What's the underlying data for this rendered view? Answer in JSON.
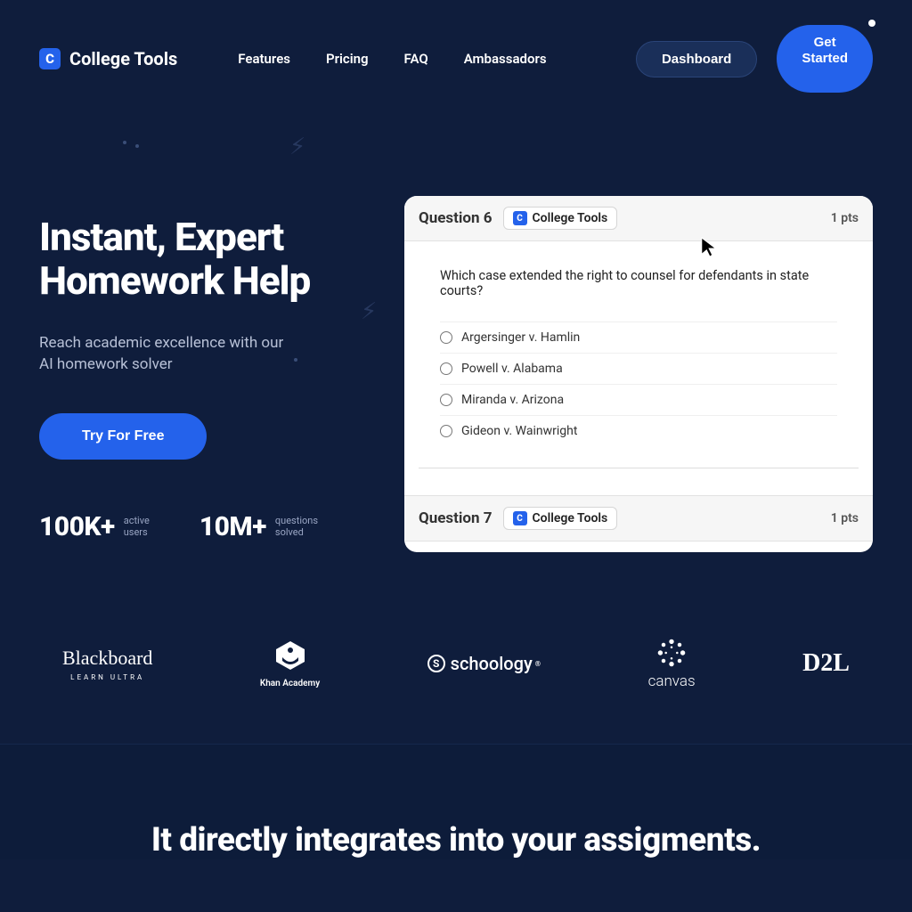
{
  "brand": {
    "logo_letter": "C",
    "name": "College Tools"
  },
  "nav": {
    "features": "Features",
    "pricing": "Pricing",
    "faq": "FAQ",
    "ambassadors": "Ambassadors"
  },
  "header_buttons": {
    "dashboard": "Dashboard",
    "get_started": "Get\nStarted"
  },
  "hero": {
    "title_line1": "Instant, Expert",
    "title_line2": "Homework Help",
    "sub_line1": "Reach academic excellence with our",
    "sub_line2": "AI homework solver",
    "try_button": "Try For Free"
  },
  "stats": {
    "stat1": {
      "num": "100K+",
      "label_line1": "active",
      "label_line2": "users"
    },
    "stat2": {
      "num": "10M+",
      "label_line1": "questions",
      "label_line2": "solved"
    }
  },
  "mockup": {
    "q6": {
      "label": "Question 6",
      "chip_letter": "C",
      "chip_text": "College Tools",
      "pts": "1 pts",
      "text": "Which case extended the right to counsel for defendants in state courts?",
      "options": [
        "Argersinger v. Hamlin",
        "Powell v. Alabama",
        "Miranda v. Arizona",
        "Gideon v. Wainwright"
      ]
    },
    "q7": {
      "label": "Question 7",
      "chip_letter": "C",
      "chip_text": "College Tools",
      "pts": "1 pts"
    }
  },
  "partners": {
    "blackboard": "Blackboard",
    "blackboard_sub": "LEARN ULTRA",
    "khan": "Khan Academy",
    "schoology": "schoology",
    "canvas": "canvas",
    "d2l": "D2L"
  },
  "section2": {
    "title": "It directly integrates into your assigments."
  }
}
